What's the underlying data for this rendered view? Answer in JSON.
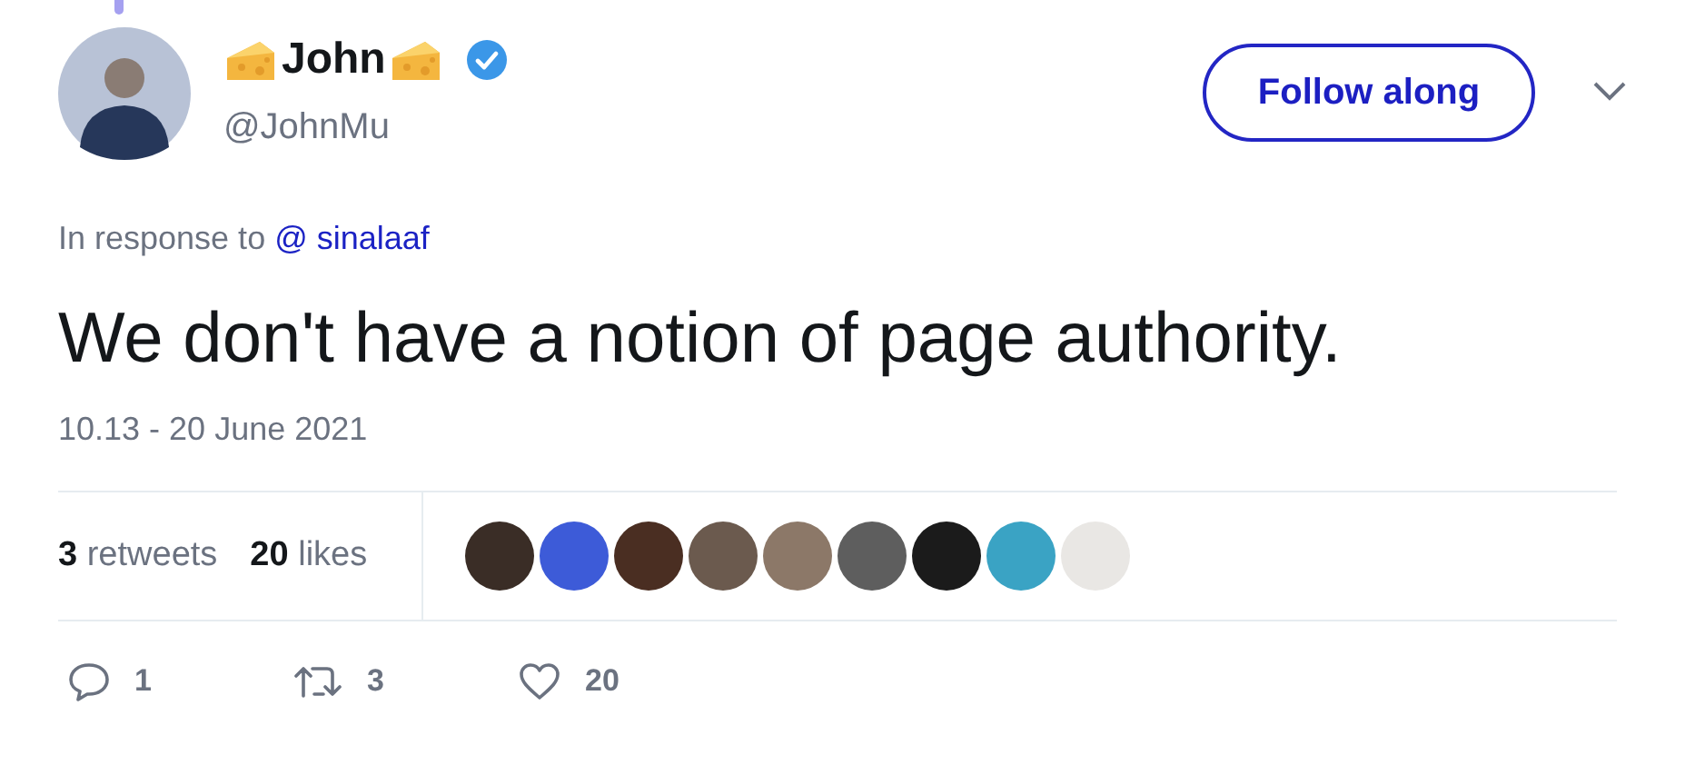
{
  "author": {
    "name": "John",
    "verified": true,
    "handle": "@JohnMu"
  },
  "follow_button": {
    "label": "Follow along"
  },
  "reply_to": {
    "prefix": "In response to",
    "mention": "@ sinalaaf"
  },
  "text": "We don't have a notion of page authority.",
  "timestamp": "10.13 - 20 June 2021",
  "stats": [
    {
      "count": "3",
      "label": "retweets"
    },
    {
      "count": "20",
      "label": "likes"
    }
  ],
  "likers": [
    {
      "color": "#3a2d26"
    },
    {
      "color": "#3d5bd8"
    },
    {
      "color": "#4a2e22"
    },
    {
      "color": "#6b5a4e"
    },
    {
      "color": "#8c7868"
    },
    {
      "color": "#5e5e5e"
    },
    {
      "color": "#1b1b1b"
    },
    {
      "color": "#3aa3c4"
    },
    {
      "color": "#e9e7e4"
    }
  ],
  "actions": [
    {
      "kind": "reply",
      "count": "1"
    },
    {
      "kind": "retweet",
      "count": "3"
    },
    {
      "kind": "like",
      "count": "20"
    }
  ]
}
